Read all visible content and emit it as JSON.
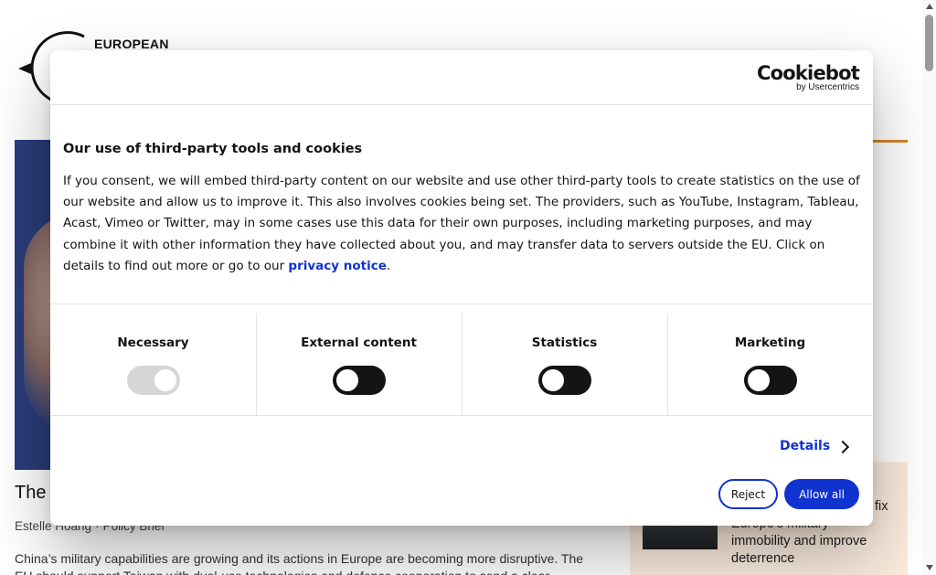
{
  "site": {
    "logo_text": "EUROPEAN"
  },
  "article": {
    "title": "The T",
    "author": "Estelle Hoang",
    "separator": "·",
    "type": "Policy Brief",
    "excerpt": "China’s military capabilities are growing and its actions in Europe are becoming more disruptive. The EU should support Taiwan with dual-use technologies and defence cooperation to send a clear"
  },
  "side_card": {
    "title_fragment": "fix",
    "title_lines": [
      "Europe’s military",
      "immobility and improve",
      "deterrence"
    ]
  },
  "cookie_dialog": {
    "brand_wordmark": "Cookiebot",
    "brand_sub": "by Usercentrics",
    "title": "Our use of third-party tools and cookies",
    "body": "If you consent, we will embed third-party content on our website and use other third-party tools to create statistics on the use of our website and allow us to improve it. This also involves cookies being set. The providers, such as YouTube, Instagram, Tableau, Acast, Vimeo  or Twitter, may in some cases use this data for their own purposes, including marketing purposes, and may combine it with other information they have collected about you, and may transfer data to servers outside the EU. Click on details to find out more or go to our ",
    "privacy_link": "privacy notice",
    "body_end": ".",
    "categories": [
      {
        "label": "Necessary",
        "enabled": true,
        "locked": true
      },
      {
        "label": "External content",
        "enabled": false,
        "locked": false
      },
      {
        "label": "Statistics",
        "enabled": false,
        "locked": false
      },
      {
        "label": "Marketing",
        "enabled": false,
        "locked": false
      }
    ],
    "details_label": "Details",
    "reject_label": "Reject",
    "allow_label": "Allow all"
  },
  "colors": {
    "primary_blue": "#1032cf",
    "accent_orange": "#d9822b",
    "toggle_off": "#141414",
    "toggle_locked": "#d6d6d6"
  }
}
